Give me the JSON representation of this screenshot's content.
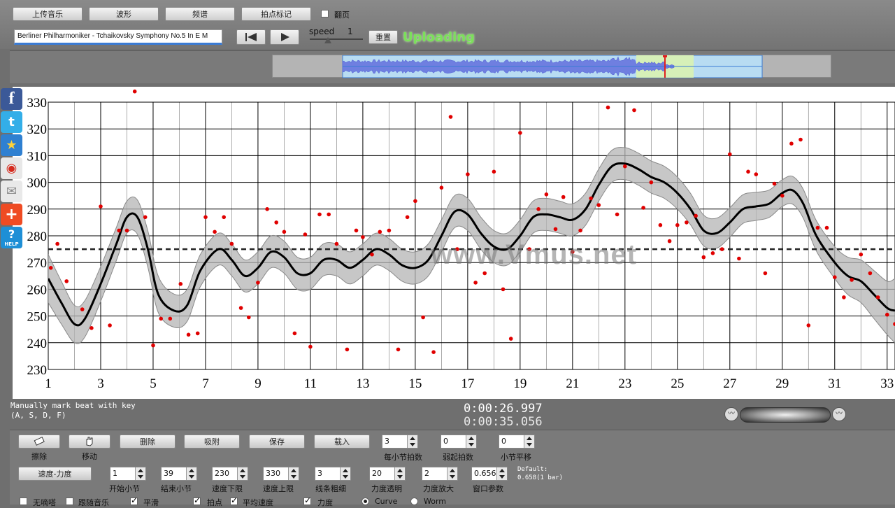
{
  "toolbar": {
    "upload_music": "上传音乐",
    "waveform": "波形",
    "spectrum": "频谱",
    "mark_beats": "拍点标记",
    "page_turn": "翻页",
    "page_turn_checked": false,
    "song_title": "Berliner Philharmoniker - Tchaikovsky Symphony No.5 In E M",
    "speed_label": "speed",
    "speed_value": "1",
    "reset": "重置",
    "status": "Uploading"
  },
  "social": {
    "icons": [
      "facebook-icon",
      "twitter-icon",
      "favorite-icon",
      "weibo-icon",
      "mail-icon",
      "add-icon",
      "help-icon"
    ],
    "help_text": "HELP"
  },
  "watermark": "www.Vmus.net",
  "chart_data": {
    "type": "line",
    "xlim": [
      1,
      33.3
    ],
    "ylim": [
      230,
      330
    ],
    "x_ticks": [
      1,
      3,
      5,
      7,
      9,
      11,
      13,
      15,
      17,
      19,
      21,
      23,
      25,
      27,
      29,
      31,
      33
    ],
    "y_ticks": [
      230,
      240,
      250,
      260,
      270,
      280,
      290,
      300,
      310,
      320,
      330
    ],
    "reference_line": 275,
    "grid": true,
    "smooth_curve": [
      [
        1,
        264
      ],
      [
        1.5,
        255
      ],
      [
        2,
        247
      ],
      [
        2.4,
        249
      ],
      [
        3,
        262
      ],
      [
        3.6,
        277
      ],
      [
        4,
        287
      ],
      [
        4.4,
        287
      ],
      [
        4.8,
        275
      ],
      [
        5.2,
        258
      ],
      [
        5.8,
        252
      ],
      [
        6.3,
        254
      ],
      [
        6.8,
        267
      ],
      [
        7.5,
        275
      ],
      [
        8,
        271
      ],
      [
        8.5,
        265
      ],
      [
        9,
        268
      ],
      [
        9.5,
        274
      ],
      [
        10,
        272
      ],
      [
        10.5,
        266
      ],
      [
        11,
        266
      ],
      [
        11.5,
        271
      ],
      [
        12,
        271
      ],
      [
        12.5,
        268
      ],
      [
        13,
        271
      ],
      [
        13.5,
        275
      ],
      [
        14,
        273
      ],
      [
        14.5,
        269
      ],
      [
        15,
        268
      ],
      [
        15.5,
        271
      ],
      [
        16,
        280
      ],
      [
        16.5,
        289
      ],
      [
        17,
        288
      ],
      [
        17.5,
        281
      ],
      [
        18,
        276
      ],
      [
        18.5,
        275
      ],
      [
        19,
        280
      ],
      [
        19.5,
        287
      ],
      [
        20,
        288
      ],
      [
        20.5,
        287
      ],
      [
        21,
        286
      ],
      [
        21.5,
        290
      ],
      [
        22,
        299
      ],
      [
        22.5,
        306
      ],
      [
        23,
        307
      ],
      [
        23.5,
        305
      ],
      [
        24,
        302
      ],
      [
        24.5,
        300
      ],
      [
        25,
        296
      ],
      [
        25.5,
        290
      ],
      [
        26,
        282
      ],
      [
        26.5,
        281
      ],
      [
        27,
        285
      ],
      [
        27.5,
        290
      ],
      [
        28,
        291
      ],
      [
        28.5,
        292
      ],
      [
        29,
        296
      ],
      [
        29.4,
        297
      ],
      [
        29.8,
        292
      ],
      [
        30.3,
        280
      ],
      [
        31,
        270
      ],
      [
        31.5,
        265
      ],
      [
        32,
        263
      ],
      [
        32.5,
        258
      ],
      [
        33,
        253
      ],
      [
        33.3,
        252
      ]
    ],
    "band_halfwidth": [
      [
        1,
        9
      ],
      [
        2,
        7
      ],
      [
        4,
        6
      ],
      [
        5,
        7
      ],
      [
        6,
        6
      ],
      [
        10,
        6
      ],
      [
        15,
        6
      ],
      [
        17,
        6
      ],
      [
        20,
        6
      ],
      [
        23,
        6
      ],
      [
        25,
        6
      ],
      [
        29,
        5
      ],
      [
        31,
        6
      ],
      [
        33,
        10
      ],
      [
        33.3,
        12
      ]
    ],
    "points": [
      [
        1.1,
        268
      ],
      [
        1.35,
        277
      ],
      [
        1.7,
        263
      ],
      [
        2.3,
        252.5
      ],
      [
        2.65,
        245.5
      ],
      [
        3,
        291
      ],
      [
        3.35,
        246.5
      ],
      [
        3.7,
        282
      ],
      [
        4,
        282
      ],
      [
        4.3,
        334
      ],
      [
        4.7,
        287
      ],
      [
        5,
        239
      ],
      [
        5.3,
        249
      ],
      [
        5.65,
        249
      ],
      [
        6.05,
        262
      ],
      [
        6.35,
        243
      ],
      [
        6.7,
        243.5
      ],
      [
        7,
        287
      ],
      [
        7.35,
        281.5
      ],
      [
        7.7,
        287
      ],
      [
        8,
        277
      ],
      [
        8.35,
        253
      ],
      [
        8.65,
        249.5
      ],
      [
        9,
        262.5
      ],
      [
        9.35,
        290
      ],
      [
        9.7,
        285
      ],
      [
        10,
        281.5
      ],
      [
        10.4,
        243.5
      ],
      [
        10.8,
        280.5
      ],
      [
        11,
        238.5
      ],
      [
        11.35,
        288
      ],
      [
        11.7,
        288
      ],
      [
        12,
        277
      ],
      [
        12.4,
        237.5
      ],
      [
        12.75,
        282
      ],
      [
        13,
        279.5
      ],
      [
        13.35,
        273
      ],
      [
        13.65,
        281.5
      ],
      [
        14,
        282
      ],
      [
        14.35,
        237.5
      ],
      [
        14.7,
        287
      ],
      [
        15,
        293
      ],
      [
        15.3,
        249.5
      ],
      [
        15.7,
        236.5
      ],
      [
        16,
        298
      ],
      [
        16.35,
        324.5
      ],
      [
        16.6,
        275
      ],
      [
        17,
        303
      ],
      [
        17.3,
        262.5
      ],
      [
        17.65,
        266
      ],
      [
        18,
        304
      ],
      [
        18.35,
        260
      ],
      [
        18.65,
        241.5
      ],
      [
        19,
        318.5
      ],
      [
        19.35,
        275
      ],
      [
        19.7,
        290
      ],
      [
        20,
        295.5
      ],
      [
        20.35,
        282.5
      ],
      [
        20.65,
        294.5
      ],
      [
        21,
        274
      ],
      [
        21.3,
        282
      ],
      [
        21.7,
        294
      ],
      [
        22,
        291.5
      ],
      [
        22.35,
        328
      ],
      [
        22.7,
        288
      ],
      [
        23,
        306
      ],
      [
        23.35,
        327
      ],
      [
        23.7,
        290.5
      ],
      [
        24,
        300
      ],
      [
        24.35,
        284
      ],
      [
        24.7,
        278
      ],
      [
        25,
        284
      ],
      [
        25.35,
        285
      ],
      [
        25.7,
        287.5
      ],
      [
        26,
        272
      ],
      [
        26.35,
        273.5
      ],
      [
        26.7,
        275
      ],
      [
        27,
        310.5
      ],
      [
        27.35,
        271.5
      ],
      [
        27.7,
        304
      ],
      [
        28,
        303
      ],
      [
        28.35,
        266
      ],
      [
        28.7,
        299.5
      ],
      [
        29,
        295
      ],
      [
        29.35,
        314.5
      ],
      [
        29.7,
        316
      ],
      [
        30,
        246.5
      ],
      [
        30.35,
        283
      ],
      [
        30.7,
        283
      ],
      [
        31,
        264.5
      ],
      [
        31.35,
        257
      ],
      [
        31.65,
        263.5
      ],
      [
        32,
        273
      ],
      [
        32.35,
        266
      ],
      [
        32.65,
        257
      ],
      [
        33,
        250.5
      ],
      [
        33.3,
        247
      ]
    ]
  },
  "timer": {
    "hint_line1": "Manually mark beat with key",
    "hint_line2": "(A, S, D, F)",
    "current_time": "0:00:26.997",
    "total_time": "0:00:35.056"
  },
  "bottom": {
    "erase_label": "擦除",
    "move_label": "移动",
    "delete": "删除",
    "snap": "吸附",
    "save": "保存",
    "load": "载入",
    "tempo_dynamics": "速度-力度",
    "beats_per_bar_value": "3",
    "beats_per_bar_label": "每小节拍数",
    "pickup_beats_value": "0",
    "pickup_beats_label": "弱起拍数",
    "bar_offset_value": "0",
    "bar_offset_label": "小节平移",
    "start_bar_value": "1",
    "start_bar_label": "开始小节",
    "end_bar_value": "39",
    "end_bar_label": "结束小节",
    "tempo_min_value": "230",
    "tempo_min_label": "速度下限",
    "tempo_max_value": "330",
    "tempo_max_label": "速度上限",
    "line_width_value": "3",
    "line_width_label": "线条粗细",
    "dyn_opacity_value": "20",
    "dyn_opacity_label": "力度透明",
    "dyn_scale_value": "2",
    "dyn_scale_label": "力度放大",
    "window_value": "0.65674",
    "window_label": "窗口参数",
    "default_line1": "Default:",
    "default_line2": "0.658(1 bar)",
    "no_click": "无嘀嗒",
    "follow_music": "跟随音乐",
    "smooth": "平滑",
    "beat_points": "拍点",
    "avg_tempo": "平均速度",
    "dynamics": "力度",
    "curve": "Curve",
    "worm": "Worm"
  }
}
